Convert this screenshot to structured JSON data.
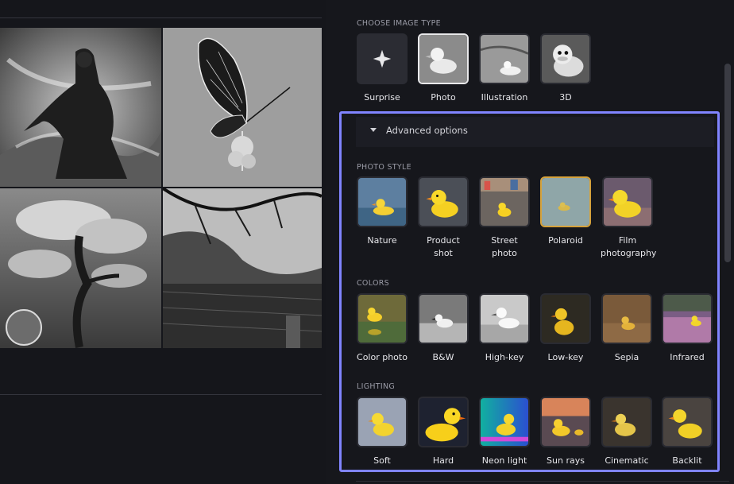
{
  "image_type": {
    "section_label": "CHOOSE IMAGE TYPE",
    "options": [
      {
        "label": "Surprise",
        "icon": "sparkle-icon"
      },
      {
        "label": "Photo",
        "selected": true
      },
      {
        "label": "Illustration"
      },
      {
        "label": "3D"
      }
    ]
  },
  "advanced": {
    "title": "Advanced options",
    "expanded": true
  },
  "photo_style": {
    "section_label": "PHOTO STYLE",
    "options": [
      {
        "label": "Nature"
      },
      {
        "label": "Product shot"
      },
      {
        "label": "Street photo"
      },
      {
        "label": "Polaroid",
        "highlighted": true
      },
      {
        "label": "Film photography"
      }
    ]
  },
  "colors": {
    "section_label": "COLORS",
    "options": [
      {
        "label": "Color photo"
      },
      {
        "label": "B&W"
      },
      {
        "label": "High-key"
      },
      {
        "label": "Low-key"
      },
      {
        "label": "Sepia"
      },
      {
        "label": "Infrared"
      }
    ]
  },
  "lighting": {
    "section_label": "LIGHTING",
    "options": [
      {
        "label": "Soft"
      },
      {
        "label": "Hard"
      },
      {
        "label": "Neon light"
      },
      {
        "label": "Sun rays"
      },
      {
        "label": "Cinematic"
      },
      {
        "label": "Backlit"
      }
    ]
  },
  "colors_accent": {
    "focus_outline": "#8084ff",
    "highlight": "#d6a23b"
  }
}
